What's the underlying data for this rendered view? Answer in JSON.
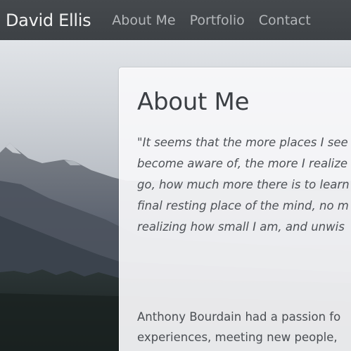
{
  "navbar": {
    "brand": "David Ellis",
    "links": [
      {
        "label": "About Me"
      },
      {
        "label": "Portfolio"
      },
      {
        "label": "Contact"
      }
    ]
  },
  "about": {
    "title": "About Me",
    "quote_lines": [
      "\"It seems that the more places I see",
      "become aware of, the more I realize",
      "go, how much more there is to learn",
      "final resting place of the mind, no m",
      "realizing how small I am, and unwis"
    ],
    "bio_lines": [
      "Anthony Bourdain had a passion fo",
      "experiences, meeting new people,"
    ]
  },
  "colors": {
    "navbar": "#424649",
    "brand_text": "#f2f2f2",
    "nav_link_text": "#b4b7ba",
    "card_background": "#f7f8fa",
    "heading_text": "#3b3f44"
  }
}
